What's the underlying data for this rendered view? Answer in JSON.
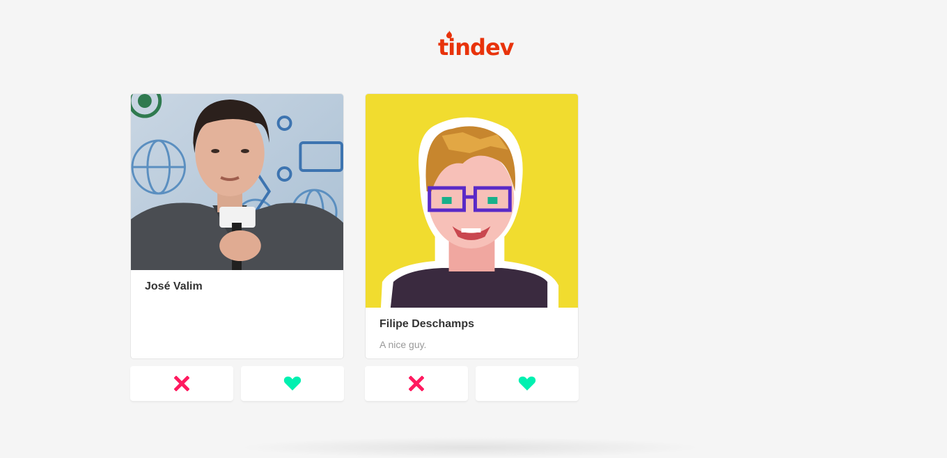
{
  "brand": {
    "logo_text": "tindev",
    "color": "#e8330b"
  },
  "devs": [
    {
      "name": "José Valim",
      "bio": "",
      "avatar": "photo-of-man-with-microphone"
    },
    {
      "name": "Filipe Deschamps",
      "bio": "A nice guy.",
      "avatar": "pixel-art-portrait"
    }
  ],
  "actions": {
    "dislike_icon": "close-x-icon",
    "dislike_color": "#ff1a5f",
    "like_icon": "heart-icon",
    "like_color": "#00f0b0"
  }
}
